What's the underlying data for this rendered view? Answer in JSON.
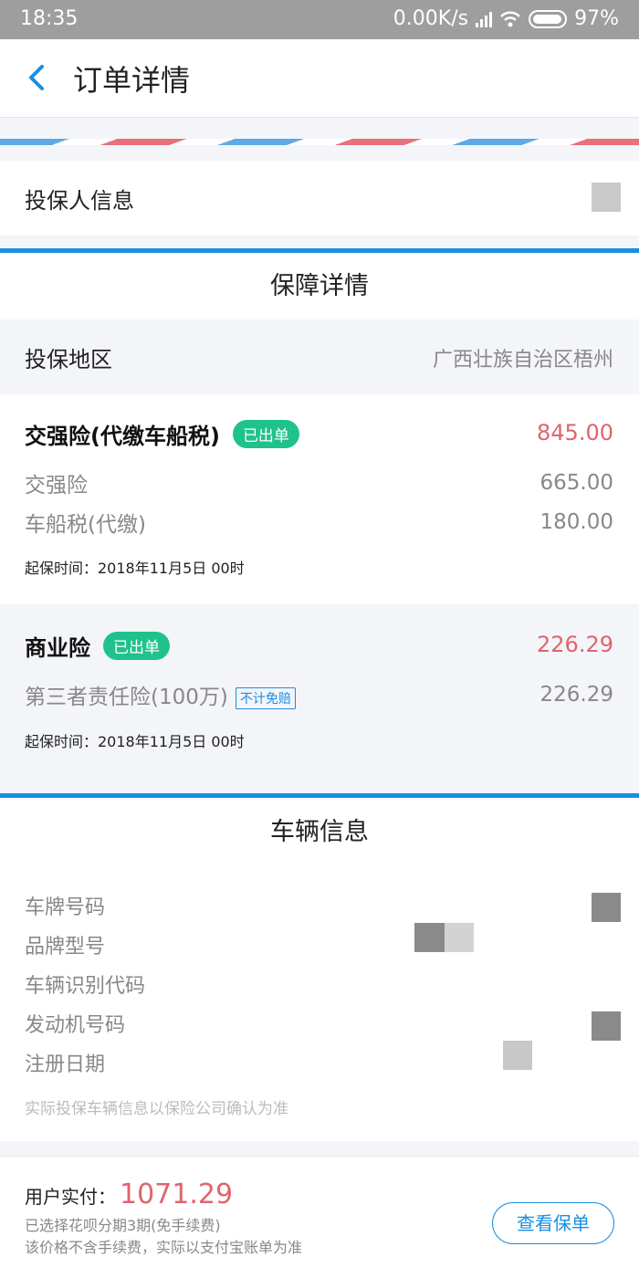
{
  "status_bar": {
    "time": "18:35",
    "network_speed": "0.00K/s",
    "battery": "97%"
  },
  "nav": {
    "title": "订单详情"
  },
  "policy_holder": {
    "label": "投保人信息"
  },
  "coverage": {
    "title": "保障详情",
    "region_label": "投保地区",
    "region_value": "广西壮族自治区梧州",
    "compulsory": {
      "title": "交强险(代缴车船税)",
      "badge": "已出单",
      "total": "845.00",
      "items": [
        {
          "name": "交强险",
          "amount": "665.00"
        },
        {
          "name": "车船税(代缴)",
          "amount": "180.00"
        }
      ],
      "start_time": "起保时间：2018年11月5日 00时"
    },
    "commercial": {
      "title": "商业险",
      "badge": "已出单",
      "total": "226.29",
      "items": [
        {
          "name": "第三者责任险(100万)",
          "tag": "不计免赔",
          "amount": "226.29"
        }
      ],
      "start_time": "起保时间：2018年11月5日 00时"
    }
  },
  "vehicle": {
    "title": "车辆信息",
    "fields": [
      {
        "label": "车牌号码"
      },
      {
        "label": "品牌型号"
      },
      {
        "label": "车辆识别代码"
      },
      {
        "label": "发动机号码"
      },
      {
        "label": "注册日期"
      }
    ],
    "note": "实际投保车辆信息以保险公司确认为准"
  },
  "footer": {
    "paid_label": "用户实付：",
    "paid_amount": "1071.29",
    "installment_note": "已选择花呗分期3期(免手续费)",
    "fee_note": "该价格不含手续费，实际以支付宝账单为准",
    "view_policy_label": "查看保单"
  },
  "colors": {
    "accent_blue": "#1a8fe3",
    "price_red": "#e0646e",
    "badge_green": "#1fc28a"
  }
}
